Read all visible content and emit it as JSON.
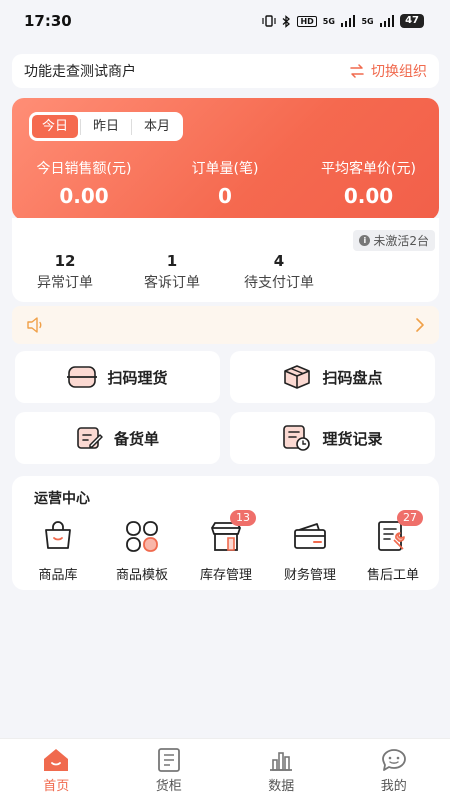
{
  "status_bar": {
    "time": "17:30",
    "battery": "47",
    "hd": "HD",
    "net1": "5G",
    "net2": "5G"
  },
  "header": {
    "merchant_name": "功能走查测试商户",
    "switch_label": "切换组织"
  },
  "summary": {
    "tabs": [
      {
        "label": "今日",
        "active": true
      },
      {
        "label": "昨日",
        "active": false
      },
      {
        "label": "本月",
        "active": false
      }
    ],
    "metrics": [
      {
        "label": "今日销售额(元)",
        "value": "0.00"
      },
      {
        "label": "订单量(笔)",
        "value": "0"
      },
      {
        "label": "平均客单价(元)",
        "value": "0.00"
      }
    ]
  },
  "orders": {
    "inactive_badge": "未激活2台",
    "stats": [
      {
        "count": "12",
        "label": "异常订单"
      },
      {
        "count": "1",
        "label": "客诉订单"
      },
      {
        "count": "4",
        "label": "待支付订单"
      }
    ]
  },
  "notice": {
    "icon": "speaker-icon"
  },
  "actions": [
    {
      "label": "扫码理货",
      "icon": "scan-restock-icon"
    },
    {
      "label": "扫码盘点",
      "icon": "scan-inventory-box-icon"
    },
    {
      "label": "备货单",
      "icon": "stock-order-icon"
    },
    {
      "label": "理货记录",
      "icon": "restock-record-icon"
    }
  ],
  "ops_center": {
    "title": "运营中心",
    "items": [
      {
        "label": "商品库",
        "icon": "shopping-bag-icon",
        "badge": ""
      },
      {
        "label": "商品模板",
        "icon": "template-grid-icon",
        "badge": ""
      },
      {
        "label": "库存管理",
        "icon": "store-icon",
        "badge": "13"
      },
      {
        "label": "财务管理",
        "icon": "wallet-icon",
        "badge": ""
      },
      {
        "label": "售后工单",
        "icon": "wrench-doc-icon",
        "badge": "27"
      }
    ]
  },
  "bottom_nav": [
    {
      "label": "首页",
      "icon": "home-icon",
      "active": true
    },
    {
      "label": "货柜",
      "icon": "cabinet-icon",
      "active": false
    },
    {
      "label": "数据",
      "icon": "bar-chart-icon",
      "active": false
    },
    {
      "label": "我的",
      "icon": "profile-icon",
      "active": false
    }
  ],
  "colors": {
    "accent": "#f06a4e",
    "background": "#f4f5f9",
    "badge": "#ef6f6a"
  }
}
